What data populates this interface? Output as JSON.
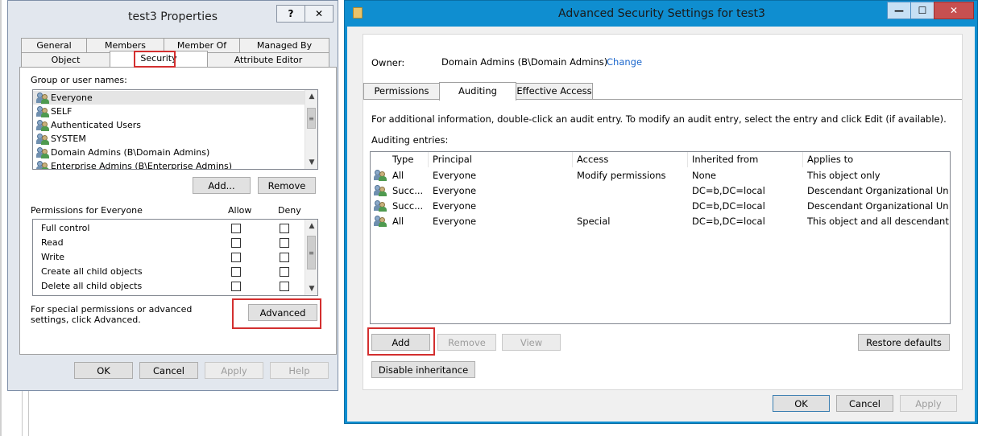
{
  "props": {
    "title": "test3 Properties",
    "help_btn": "?",
    "close_btn": "✕",
    "tabs_row1": [
      "General",
      "Members",
      "Member Of",
      "Managed By"
    ],
    "tabs_row2": [
      "Object",
      "Security",
      "Attribute Editor"
    ],
    "group_label": "Group or user names:",
    "users": [
      "Everyone",
      "SELF",
      "Authenticated Users",
      "SYSTEM",
      "Domain Admins (B\\Domain Admins)",
      "Enterprise Admins (B\\Enterprise Admins)"
    ],
    "add_btn": "Add...",
    "remove_btn": "Remove",
    "perm_label": "Permissions for Everyone",
    "allow_label": "Allow",
    "deny_label": "Deny",
    "permissions": [
      "Full control",
      "Read",
      "Write",
      "Create all child objects",
      "Delete all child objects"
    ],
    "special_text": "For special permissions or advanced settings, click Advanced.",
    "advanced_btn": "Advanced",
    "ok": "OK",
    "cancel": "Cancel",
    "apply": "Apply",
    "help": "Help"
  },
  "adv": {
    "title": "Advanced Security Settings for test3",
    "owner_label": "Owner:",
    "owner_value": "Domain Admins (B\\Domain Admins)",
    "change_link": "Change",
    "tabs": [
      "Permissions",
      "Auditing",
      "Effective Access"
    ],
    "info_text": "For additional information, double-click an audit entry. To modify an audit entry, select the entry and click Edit (if available).",
    "entries_label": "Auditing entries:",
    "columns": [
      "Type",
      "Principal",
      "Access",
      "Inherited from",
      "Applies to"
    ],
    "rows": [
      [
        "All",
        "Everyone",
        "Modify permissions",
        "None",
        "This object only"
      ],
      [
        "Succ...",
        "Everyone",
        "",
        "DC=b,DC=local",
        "Descendant Organizational Un..."
      ],
      [
        "Succ...",
        "Everyone",
        "",
        "DC=b,DC=local",
        "Descendant Organizational Un..."
      ],
      [
        "All",
        "Everyone",
        "Special",
        "DC=b,DC=local",
        "This object and all descendant..."
      ]
    ],
    "add_btn": "Add",
    "remove_btn": "Remove",
    "view_btn": "View",
    "restore_btn": "Restore defaults",
    "disable_btn": "Disable inheritance",
    "ok": "OK",
    "cancel": "Cancel",
    "apply": "Apply",
    "min_btn": "—",
    "max_btn": "☐",
    "close_btn": "✕"
  },
  "colors": {
    "accent": "#0f8ed0",
    "highlight": "#d32f2f",
    "link": "#1a66cc"
  }
}
